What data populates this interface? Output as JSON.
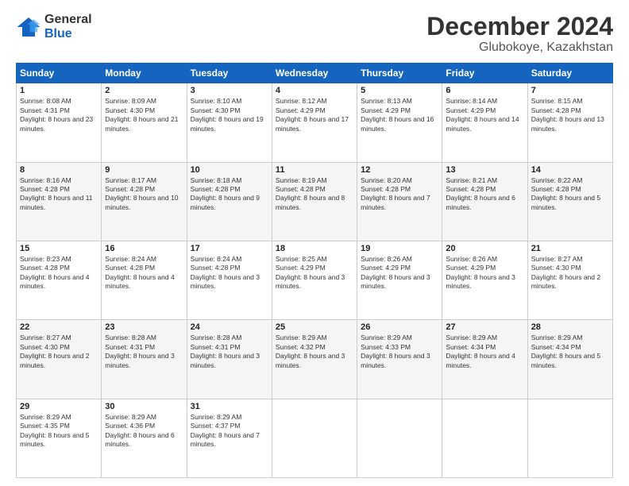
{
  "logo": {
    "general": "General",
    "blue": "Blue"
  },
  "header": {
    "month": "December 2024",
    "location": "Glubokoye, Kazakhstan"
  },
  "weekdays": [
    "Sunday",
    "Monday",
    "Tuesday",
    "Wednesday",
    "Thursday",
    "Friday",
    "Saturday"
  ],
  "weeks": [
    [
      {
        "day": "1",
        "sunrise": "8:08 AM",
        "sunset": "4:31 PM",
        "daylight": "8 hours and 23 minutes."
      },
      {
        "day": "2",
        "sunrise": "8:09 AM",
        "sunset": "4:30 PM",
        "daylight": "8 hours and 21 minutes."
      },
      {
        "day": "3",
        "sunrise": "8:10 AM",
        "sunset": "4:30 PM",
        "daylight": "8 hours and 19 minutes."
      },
      {
        "day": "4",
        "sunrise": "8:12 AM",
        "sunset": "4:29 PM",
        "daylight": "8 hours and 17 minutes."
      },
      {
        "day": "5",
        "sunrise": "8:13 AM",
        "sunset": "4:29 PM",
        "daylight": "8 hours and 16 minutes."
      },
      {
        "day": "6",
        "sunrise": "8:14 AM",
        "sunset": "4:29 PM",
        "daylight": "8 hours and 14 minutes."
      },
      {
        "day": "7",
        "sunrise": "8:15 AM",
        "sunset": "4:28 PM",
        "daylight": "8 hours and 13 minutes."
      }
    ],
    [
      {
        "day": "8",
        "sunrise": "8:16 AM",
        "sunset": "4:28 PM",
        "daylight": "8 hours and 11 minutes."
      },
      {
        "day": "9",
        "sunrise": "8:17 AM",
        "sunset": "4:28 PM",
        "daylight": "8 hours and 10 minutes."
      },
      {
        "day": "10",
        "sunrise": "8:18 AM",
        "sunset": "4:28 PM",
        "daylight": "8 hours and 9 minutes."
      },
      {
        "day": "11",
        "sunrise": "8:19 AM",
        "sunset": "4:28 PM",
        "daylight": "8 hours and 8 minutes."
      },
      {
        "day": "12",
        "sunrise": "8:20 AM",
        "sunset": "4:28 PM",
        "daylight": "8 hours and 7 minutes."
      },
      {
        "day": "13",
        "sunrise": "8:21 AM",
        "sunset": "4:28 PM",
        "daylight": "8 hours and 6 minutes."
      },
      {
        "day": "14",
        "sunrise": "8:22 AM",
        "sunset": "4:28 PM",
        "daylight": "8 hours and 5 minutes."
      }
    ],
    [
      {
        "day": "15",
        "sunrise": "8:23 AM",
        "sunset": "4:28 PM",
        "daylight": "8 hours and 4 minutes."
      },
      {
        "day": "16",
        "sunrise": "8:24 AM",
        "sunset": "4:28 PM",
        "daylight": "8 hours and 4 minutes."
      },
      {
        "day": "17",
        "sunrise": "8:24 AM",
        "sunset": "4:28 PM",
        "daylight": "8 hours and 3 minutes."
      },
      {
        "day": "18",
        "sunrise": "8:25 AM",
        "sunset": "4:29 PM",
        "daylight": "8 hours and 3 minutes."
      },
      {
        "day": "19",
        "sunrise": "8:26 AM",
        "sunset": "4:29 PM",
        "daylight": "8 hours and 3 minutes."
      },
      {
        "day": "20",
        "sunrise": "8:26 AM",
        "sunset": "4:29 PM",
        "daylight": "8 hours and 3 minutes."
      },
      {
        "day": "21",
        "sunrise": "8:27 AM",
        "sunset": "4:30 PM",
        "daylight": "8 hours and 2 minutes."
      }
    ],
    [
      {
        "day": "22",
        "sunrise": "8:27 AM",
        "sunset": "4:30 PM",
        "daylight": "8 hours and 2 minutes."
      },
      {
        "day": "23",
        "sunrise": "8:28 AM",
        "sunset": "4:31 PM",
        "daylight": "8 hours and 3 minutes."
      },
      {
        "day": "24",
        "sunrise": "8:28 AM",
        "sunset": "4:31 PM",
        "daylight": "8 hours and 3 minutes."
      },
      {
        "day": "25",
        "sunrise": "8:29 AM",
        "sunset": "4:32 PM",
        "daylight": "8 hours and 3 minutes."
      },
      {
        "day": "26",
        "sunrise": "8:29 AM",
        "sunset": "4:33 PM",
        "daylight": "8 hours and 3 minutes."
      },
      {
        "day": "27",
        "sunrise": "8:29 AM",
        "sunset": "4:34 PM",
        "daylight": "8 hours and 4 minutes."
      },
      {
        "day": "28",
        "sunrise": "8:29 AM",
        "sunset": "4:34 PM",
        "daylight": "8 hours and 5 minutes."
      }
    ],
    [
      {
        "day": "29",
        "sunrise": "8:29 AM",
        "sunset": "4:35 PM",
        "daylight": "8 hours and 5 minutes."
      },
      {
        "day": "30",
        "sunrise": "8:29 AM",
        "sunset": "4:36 PM",
        "daylight": "8 hours and 6 minutes."
      },
      {
        "day": "31",
        "sunrise": "8:29 AM",
        "sunset": "4:37 PM",
        "daylight": "8 hours and 7 minutes."
      },
      null,
      null,
      null,
      null
    ]
  ]
}
